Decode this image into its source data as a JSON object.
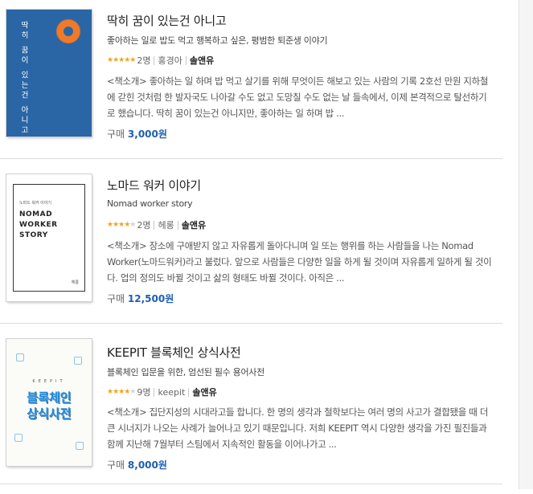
{
  "books": [
    {
      "title": "딱히 꿈이 있는건 아니고",
      "subtitle": "좋아하는 일로 밥도 먹고 행복하고 싶은, 평범한 퇴준생 이야기",
      "rating_stars": 5,
      "rating_count": "2명",
      "author": "홍경아",
      "publisher": "솔앤유",
      "description": "<책소개> 좋아하는 일 하며 밥 먹고 살기를 위해 무엇이든 해보고 있는 사람의 기록 2호선 만원 지하철에 갇힌 것처럼 한 발자국도 나아갈 수도 없고 도망칠 수도 없는 날 들속에서, 이제 본격적으로 탈선하기로 했습니다. 딱히 꿈이 있는건 아니지만, 좋아하는 일 하며 밥 ...",
      "price_label": "구매",
      "price": "3,000원",
      "cover": {
        "vertical_text": "딱히 꿈이 있는건 아니고",
        "bg_color": "#2a66a6",
        "accent_color": "#f07a2a"
      }
    },
    {
      "title": "노마드 워커 이야기",
      "subtitle": "Nomad worker story",
      "rating_stars": 4,
      "rating_count": "2명",
      "author": "헤롱",
      "publisher": "솔앤유",
      "description": "<책소개> 장소에 구애받지 않고 자유롭게 돌아다니며 일 또는 행위를 하는 사람들을 나는 Nomad Worker(노마드워커)라고 불렀다. 앞으로 사람들은 다양한 일을 하게 될 것이며 자유롭게 일하게 될 것이다. 업의 정의도 바뀔 것이고 삶의 형태도 바뀔 것이다. 아직은 ...",
      "price_label": "구매",
      "price": "12,500원",
      "cover": {
        "small_text": "노마드 워커 이야기",
        "big_line1": "NOMAD",
        "big_line2": "WORKER",
        "big_line3": "STORY",
        "author_text": "헤롱"
      }
    },
    {
      "title": "KEEPIT 블록체인 상식사전",
      "subtitle": "블록체인 입문을 위한, 엄선된 필수 용어사전",
      "rating_stars": 4,
      "rating_count": "9명",
      "author": "keepit",
      "publisher": "솔앤유",
      "description": "<책소개> 집단지성의 시대라고들 합니다. 한 명의 생각과 철학보다는 여러 명의 사고가 결합됐을 때 더 큰 시너지가 나오는 사례가 늘어나고 있기 때문입니다. 저희 KEEPIT 역시 다양한 생각을 가진 필진들과 함께 지난해 7월부터 스팀에서 지속적인 활동을 이어나가고 ...",
      "price_label": "구매",
      "price": "8,000원",
      "cover": {
        "keepit_text": "KEEPIT",
        "line1": "블록체인",
        "line2": "상식사전"
      }
    }
  ],
  "colors": {
    "star": "#f2a51a",
    "price": "#1e5fb0",
    "divider": "#dcdcdc"
  }
}
